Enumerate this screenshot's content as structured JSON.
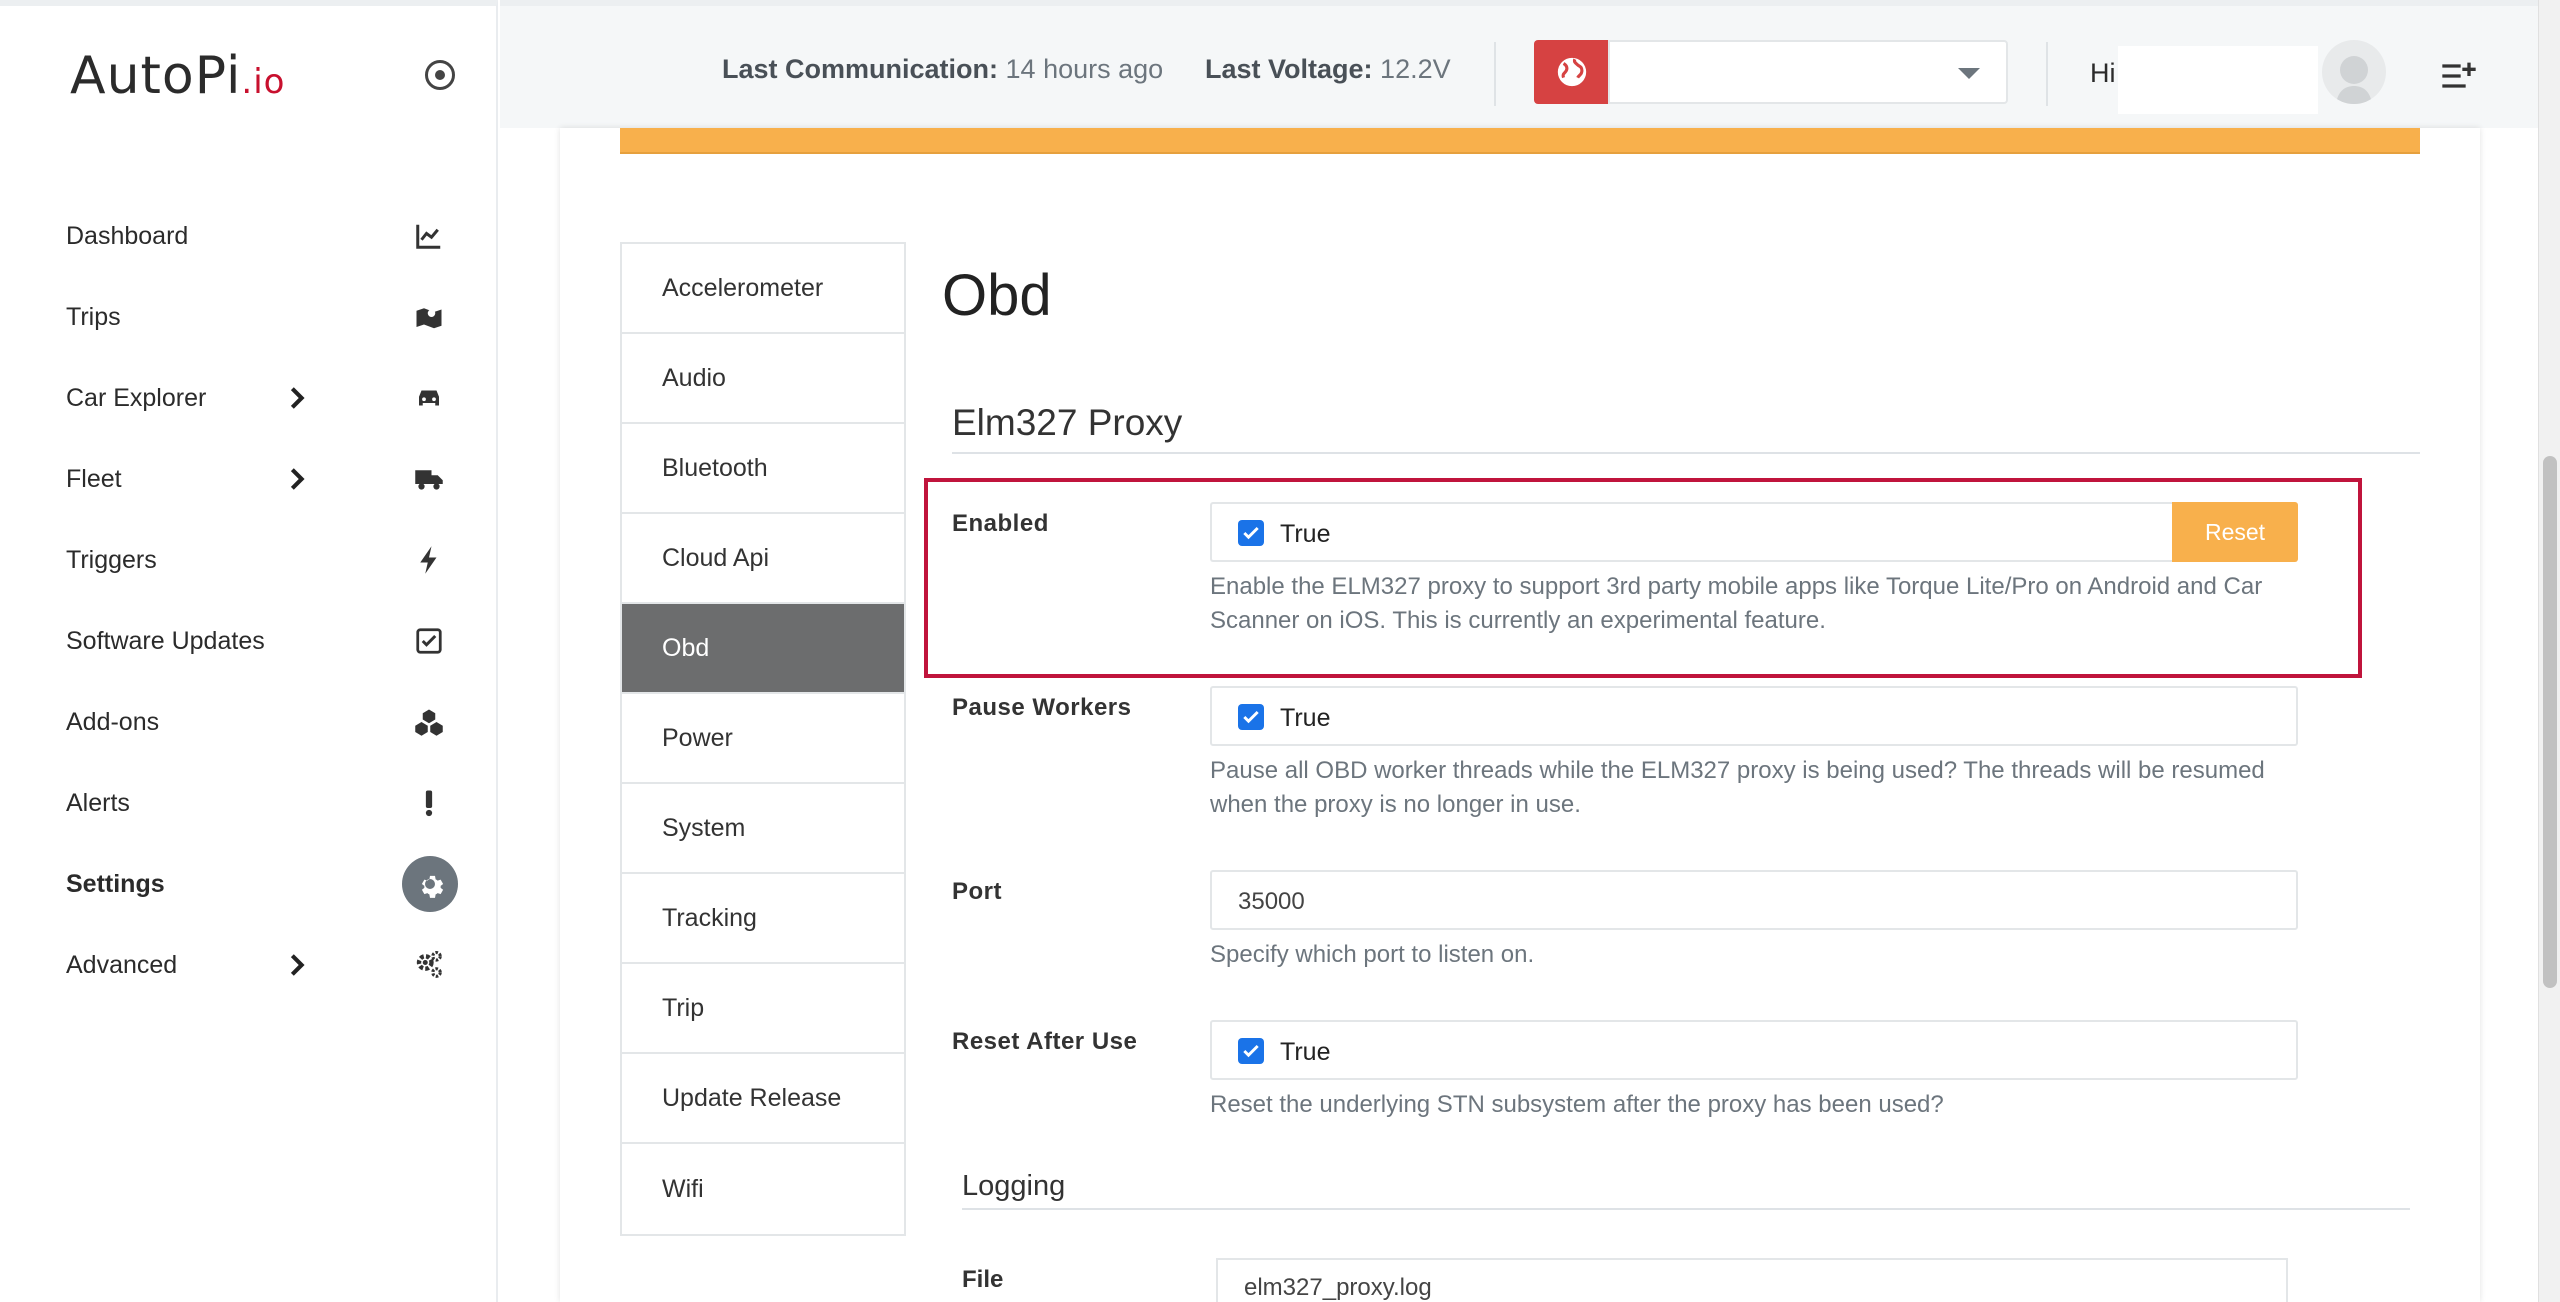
{
  "brand": {
    "logo_main": "AutoPi",
    "logo_suffix": ".io"
  },
  "sidebar": {
    "items": [
      {
        "label": "Dashboard",
        "icon": "chart-line-icon"
      },
      {
        "label": "Trips",
        "icon": "map-marker-icon"
      },
      {
        "label": "Car Explorer",
        "icon": "car-icon",
        "has_chevron": true
      },
      {
        "label": "Fleet",
        "icon": "truck-icon",
        "has_chevron": true
      },
      {
        "label": "Triggers",
        "icon": "bolt-icon"
      },
      {
        "label": "Software Updates",
        "icon": "check-square-icon"
      },
      {
        "label": "Add-ons",
        "icon": "cubes-icon"
      },
      {
        "label": "Alerts",
        "icon": "exclamation-icon"
      },
      {
        "label": "Settings",
        "icon": "gear-icon",
        "active": true
      },
      {
        "label": "Advanced",
        "icon": "gears-icon",
        "has_chevron": true
      }
    ]
  },
  "topbar": {
    "last_comm_label": "Last Communication:",
    "last_comm_value": "14 hours ago",
    "last_volt_label": "Last Voltage:",
    "last_volt_value": "12.2V",
    "device_select_value": "",
    "greeting": "Hi"
  },
  "tabs": [
    {
      "label": "Accelerometer"
    },
    {
      "label": "Audio"
    },
    {
      "label": "Bluetooth"
    },
    {
      "label": "Cloud Api"
    },
    {
      "label": "Obd",
      "active": true
    },
    {
      "label": "Power"
    },
    {
      "label": "System"
    },
    {
      "label": "Tracking"
    },
    {
      "label": "Trip"
    },
    {
      "label": "Update Release"
    },
    {
      "label": "Wifi"
    }
  ],
  "content": {
    "page_title": "Obd",
    "section_title": "Elm327 Proxy",
    "fields": {
      "enabled": {
        "label": "Enabled",
        "checkbox_label": "True",
        "checked": true,
        "reset_label": "Reset",
        "help": "Enable the ELM327 proxy to support 3rd party mobile apps like Torque Lite/Pro on Android and Car Scanner on iOS. This is currently an experimental feature."
      },
      "pause_workers": {
        "label": "Pause Workers",
        "checkbox_label": "True",
        "checked": true,
        "help": "Pause all OBD worker threads while the ELM327 proxy is being used? The threads will be resumed when the proxy is no longer in use."
      },
      "port": {
        "label": "Port",
        "value": "35000",
        "help": "Specify which port to listen on."
      },
      "reset_after_use": {
        "label": "Reset After Use",
        "checkbox_label": "True",
        "checked": true,
        "help": "Reset the underlying STN subsystem after the proxy has been used?"
      }
    },
    "logging_title": "Logging",
    "file": {
      "label": "File",
      "value": "elm327_proxy.log"
    }
  },
  "colors": {
    "accent_warning": "#f8b04c",
    "highlight_border": "#c0143c",
    "globe_button": "#d64242",
    "active_tab": "#6c6d6e",
    "checkbox": "#1a73e8"
  }
}
